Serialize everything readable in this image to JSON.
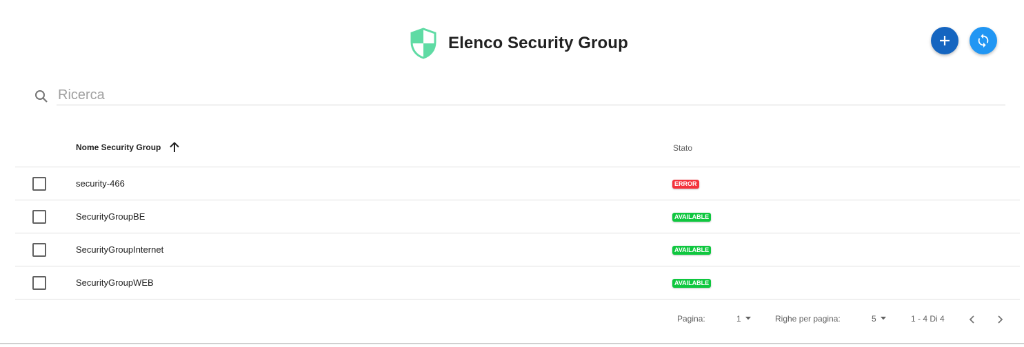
{
  "header": {
    "title": "Elenco Security Group",
    "logo_icon": "shield-icon",
    "add_button_icon": "plus-icon",
    "refresh_button_icon": "sync-icon",
    "colors": {
      "shield": "#5fdba4",
      "add_button": "#1565c0",
      "refresh_button": "#2196f3"
    }
  },
  "search": {
    "placeholder": "Ricerca",
    "value": "",
    "icon": "search-icon"
  },
  "table": {
    "columns": [
      {
        "label": "Nome Security Group",
        "sort": "asc"
      },
      {
        "label": "Stato"
      }
    ],
    "rows": [
      {
        "name": "security-466",
        "status": "ERROR",
        "status_color": "#f4323c",
        "checked": false
      },
      {
        "name": "SecurityGroupBE",
        "status": "AVAILABLE",
        "status_color": "#0fc73f",
        "checked": false
      },
      {
        "name": "SecurityGroupInternet",
        "status": "AVAILABLE",
        "status_color": "#0fc73f",
        "checked": false
      },
      {
        "name": "SecurityGroupWEB",
        "status": "AVAILABLE",
        "status_color": "#0fc73f",
        "checked": false
      }
    ]
  },
  "pagination": {
    "page_label": "Pagina:",
    "page_value": "1",
    "rows_per_page_label": "Righe per pagina:",
    "rows_per_page_value": "5",
    "range_text": "1 - 4 Di 4"
  }
}
